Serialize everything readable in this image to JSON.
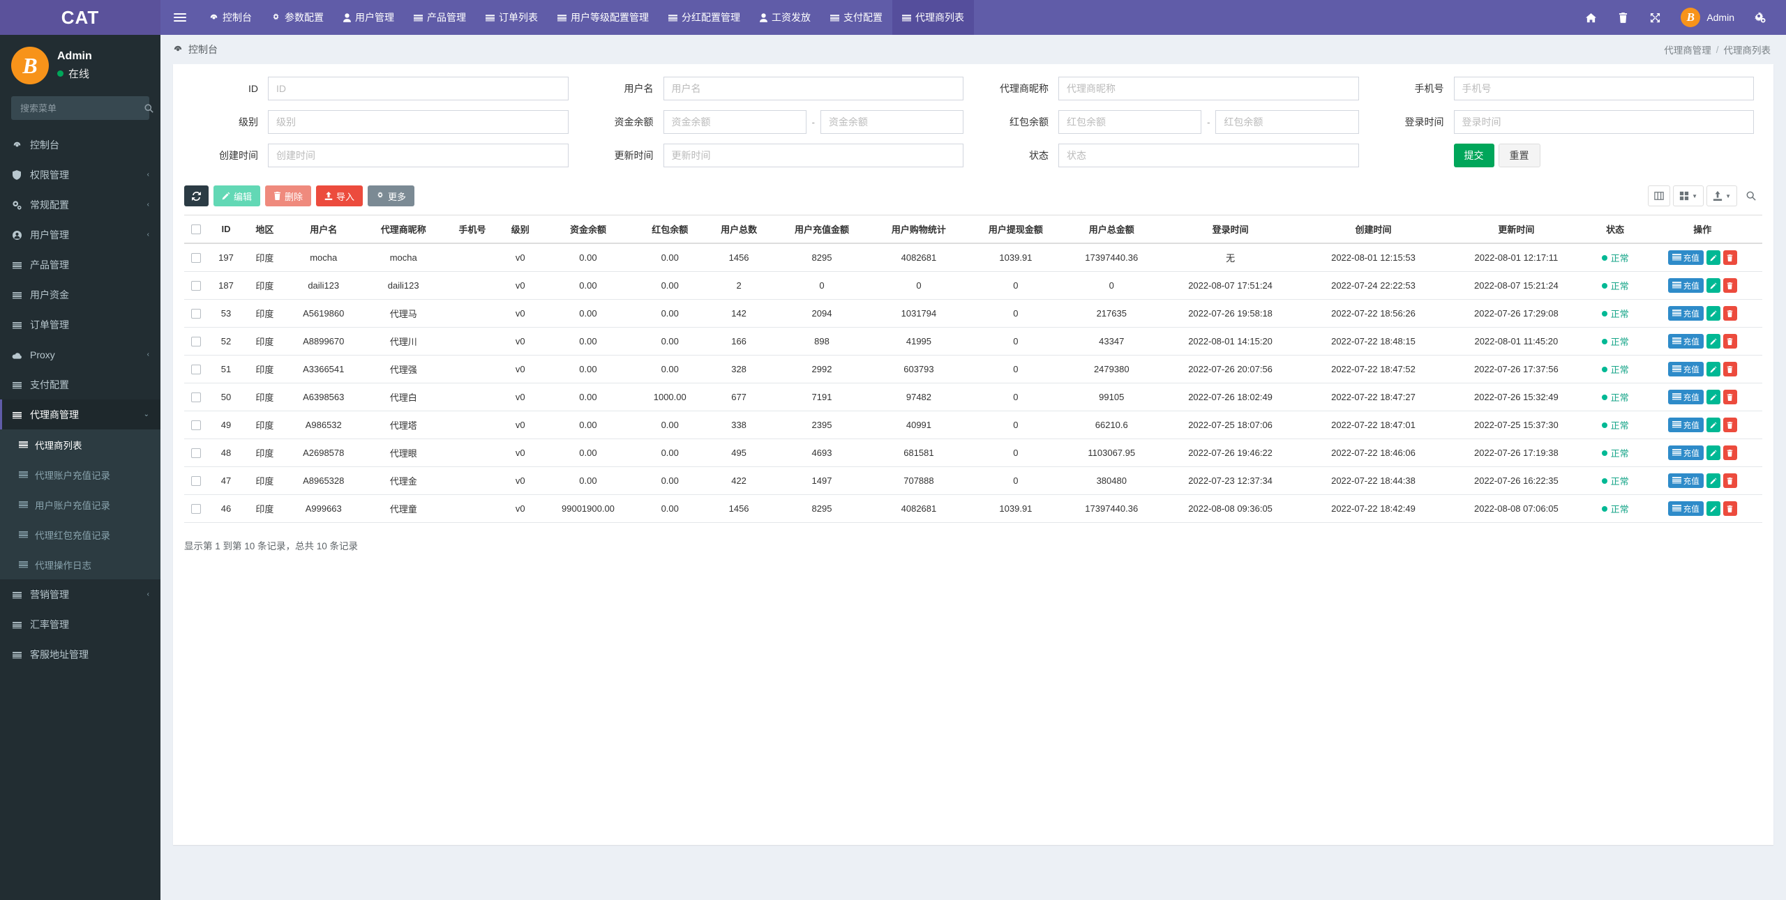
{
  "brand": {
    "title": "CAT"
  },
  "topnav": {
    "toggle_icon": "hamburger-icon",
    "items": [
      {
        "label": "控制台",
        "icon": "dashboard-icon",
        "active": false
      },
      {
        "label": "参数配置",
        "icon": "gear-icon",
        "active": false
      },
      {
        "label": "用户管理",
        "icon": "user-icon",
        "active": false
      },
      {
        "label": "产品管理",
        "icon": "list-icon",
        "active": false
      },
      {
        "label": "订单列表",
        "icon": "list-icon",
        "active": false
      },
      {
        "label": "用户等级配置管理",
        "icon": "list-icon",
        "active": false
      },
      {
        "label": "分红配置管理",
        "icon": "list-icon",
        "active": false
      },
      {
        "label": "工资发放",
        "icon": "user-icon",
        "active": false
      },
      {
        "label": "支付配置",
        "icon": "list-icon",
        "active": false
      },
      {
        "label": "代理商列表",
        "icon": "list-icon",
        "active": true
      }
    ],
    "right_icons": [
      {
        "name": "home-icon",
        "glyph": "⌂"
      },
      {
        "name": "trash-icon",
        "glyph": "Ὕ1"
      },
      {
        "name": "fullscreen-icon",
        "glyph": "⤢"
      }
    ],
    "user": {
      "name": "Admin",
      "avatar": "bitcoin-icon",
      "avatar_letter": "B"
    },
    "settings_icon": "gears-icon"
  },
  "sidebar": {
    "user": {
      "name": "Admin",
      "status": "在线",
      "avatar_letter": "B"
    },
    "search": {
      "placeholder": "搜索菜单",
      "value": "",
      "icon": "search-icon"
    },
    "menu": [
      {
        "label": "控制台",
        "icon": "dashboard-icon",
        "caret": false
      },
      {
        "label": "权限管理",
        "icon": "shield-icon",
        "caret": true
      },
      {
        "label": "常规配置",
        "icon": "gears-icon",
        "caret": true
      },
      {
        "label": "用户管理",
        "icon": "user-circle-icon",
        "caret": true
      },
      {
        "label": "产品管理",
        "icon": "list-icon",
        "caret": false
      },
      {
        "label": "用户资金",
        "icon": "list-icon",
        "caret": false
      },
      {
        "label": "订单管理",
        "icon": "list-icon",
        "caret": false
      },
      {
        "label": "Proxy",
        "icon": "cloud-icon",
        "caret": true
      },
      {
        "label": "支付配置",
        "icon": "list-icon",
        "caret": false
      },
      {
        "label": "代理商管理",
        "icon": "list-icon",
        "caret": true,
        "open": true,
        "children": [
          {
            "label": "代理商列表",
            "icon": "list-icon",
            "active": true
          },
          {
            "label": "代理账户充值记录",
            "icon": "list-icon",
            "active": false
          },
          {
            "label": "用户账户充值记录",
            "icon": "list-icon",
            "active": false
          },
          {
            "label": "代理红包充值记录",
            "icon": "list-icon",
            "active": false
          },
          {
            "label": "代理操作日志",
            "icon": "list-icon",
            "active": false
          }
        ]
      },
      {
        "label": "营销管理",
        "icon": "list-icon",
        "caret": true
      },
      {
        "label": "汇率管理",
        "icon": "list-icon",
        "caret": false
      },
      {
        "label": "客服地址管理",
        "icon": "list-icon",
        "caret": false
      }
    ]
  },
  "content_header": {
    "title": "控制台",
    "title_icon": "dashboard-icon",
    "breadcrumb": [
      "代理商管理",
      "代理商列表"
    ],
    "breadcrumb_sep": "/"
  },
  "search_form": {
    "fields": [
      {
        "label": "ID",
        "placeholder": "ID",
        "value": "",
        "type": "text"
      },
      {
        "label": "用户名",
        "placeholder": "用户名",
        "value": "",
        "type": "text"
      },
      {
        "label": "代理商昵称",
        "placeholder": "代理商昵称",
        "value": "",
        "type": "text"
      },
      {
        "label": "手机号",
        "placeholder": "手机号",
        "value": "",
        "type": "text"
      },
      {
        "label": "级别",
        "placeholder": "级别",
        "value": "",
        "type": "text"
      },
      {
        "label": "资金余额",
        "placeholder": "资金余额",
        "placeholder2": "资金余额",
        "value": "",
        "value2": "",
        "type": "range"
      },
      {
        "label": "红包余额",
        "placeholder": "红包余额",
        "placeholder2": "红包余额",
        "value": "",
        "value2": "",
        "type": "range"
      },
      {
        "label": "登录时间",
        "placeholder": "登录时间",
        "value": "",
        "type": "text"
      },
      {
        "label": "创建时间",
        "placeholder": "创建时间",
        "value": "",
        "type": "text"
      },
      {
        "label": "更新时间",
        "placeholder": "更新时间",
        "value": "",
        "type": "text"
      },
      {
        "label": "状态",
        "placeholder": "状态",
        "value": "",
        "type": "text"
      }
    ],
    "submit_label": "提交",
    "reset_label": "重置"
  },
  "toolbar": {
    "refresh_icon": "refresh-icon",
    "buttons": [
      {
        "label": "编辑",
        "icon": "pencil-icon",
        "style": "teal"
      },
      {
        "label": "删除",
        "icon": "trash-icon",
        "style": "salmon"
      },
      {
        "label": "导入",
        "icon": "upload-icon",
        "style": "red"
      },
      {
        "label": "更多",
        "icon": "gear-icon",
        "style": "gray"
      }
    ],
    "right_tools": [
      {
        "name": "columns-icon"
      },
      {
        "name": "grid-icon"
      },
      {
        "name": "export-icon"
      },
      {
        "name": "search-icon"
      }
    ]
  },
  "table": {
    "columns": [
      "ID",
      "地区",
      "用户名",
      "代理商昵称",
      "手机号",
      "级别",
      "资金余额",
      "红包余额",
      "用户总数",
      "用户充值金额",
      "用户购物统计",
      "用户提现金额",
      "用户总金额",
      "登录时间",
      "创建时间",
      "更新时间",
      "状态",
      "操作"
    ],
    "rows": [
      {
        "id": "197",
        "region": "印度",
        "username": "mocha",
        "nickname": "mocha",
        "phone": "",
        "level": "v0",
        "balance": "0.00",
        "redpacket": "0.00",
        "user_total": "1456",
        "user_recharge": "8295",
        "user_shopping": "4082681",
        "user_withdraw": "1039.91",
        "user_amount": "17397440.36",
        "login_time": "无",
        "create_time": "2022-08-01 12:15:53",
        "update_time": "2022-08-01 12:17:11",
        "status": "正常"
      },
      {
        "id": "187",
        "region": "印度",
        "username": "daili123",
        "nickname": "daili123",
        "phone": "",
        "level": "v0",
        "balance": "0.00",
        "redpacket": "0.00",
        "user_total": "2",
        "user_recharge": "0",
        "user_shopping": "0",
        "user_withdraw": "0",
        "user_amount": "0",
        "login_time": "2022-08-07 17:51:24",
        "create_time": "2022-07-24 22:22:53",
        "update_time": "2022-08-07 15:21:24",
        "status": "正常"
      },
      {
        "id": "53",
        "region": "印度",
        "username": "A5619860",
        "nickname": "代理马",
        "phone": "",
        "level": "v0",
        "balance": "0.00",
        "redpacket": "0.00",
        "user_total": "142",
        "user_recharge": "2094",
        "user_shopping": "1031794",
        "user_withdraw": "0",
        "user_amount": "217635",
        "login_time": "2022-07-26 19:58:18",
        "create_time": "2022-07-22 18:56:26",
        "update_time": "2022-07-26 17:29:08",
        "status": "正常"
      },
      {
        "id": "52",
        "region": "印度",
        "username": "A8899670",
        "nickname": "代理川",
        "phone": "",
        "level": "v0",
        "balance": "0.00",
        "redpacket": "0.00",
        "user_total": "166",
        "user_recharge": "898",
        "user_shopping": "41995",
        "user_withdraw": "0",
        "user_amount": "43347",
        "login_time": "2022-08-01 14:15:20",
        "create_time": "2022-07-22 18:48:15",
        "update_time": "2022-08-01 11:45:20",
        "status": "正常"
      },
      {
        "id": "51",
        "region": "印度",
        "username": "A3366541",
        "nickname": "代理强",
        "phone": "",
        "level": "v0",
        "balance": "0.00",
        "redpacket": "0.00",
        "user_total": "328",
        "user_recharge": "2992",
        "user_shopping": "603793",
        "user_withdraw": "0",
        "user_amount": "2479380",
        "login_time": "2022-07-26 20:07:56",
        "create_time": "2022-07-22 18:47:52",
        "update_time": "2022-07-26 17:37:56",
        "status": "正常"
      },
      {
        "id": "50",
        "region": "印度",
        "username": "A6398563",
        "nickname": "代理白",
        "phone": "",
        "level": "v0",
        "balance": "0.00",
        "redpacket": "1000.00",
        "user_total": "677",
        "user_recharge": "7191",
        "user_shopping": "97482",
        "user_withdraw": "0",
        "user_amount": "99105",
        "login_time": "2022-07-26 18:02:49",
        "create_time": "2022-07-22 18:47:27",
        "update_time": "2022-07-26 15:32:49",
        "status": "正常"
      },
      {
        "id": "49",
        "region": "印度",
        "username": "A986532",
        "nickname": "代理塔",
        "phone": "",
        "level": "v0",
        "balance": "0.00",
        "redpacket": "0.00",
        "user_total": "338",
        "user_recharge": "2395",
        "user_shopping": "40991",
        "user_withdraw": "0",
        "user_amount": "66210.6",
        "login_time": "2022-07-25 18:07:06",
        "create_time": "2022-07-22 18:47:01",
        "update_time": "2022-07-25 15:37:30",
        "status": "正常"
      },
      {
        "id": "48",
        "region": "印度",
        "username": "A2698578",
        "nickname": "代理眼",
        "phone": "",
        "level": "v0",
        "balance": "0.00",
        "redpacket": "0.00",
        "user_total": "495",
        "user_recharge": "4693",
        "user_shopping": "681581",
        "user_withdraw": "0",
        "user_amount": "1103067.95",
        "login_time": "2022-07-26 19:46:22",
        "create_time": "2022-07-22 18:46:06",
        "update_time": "2022-07-26 17:19:38",
        "status": "正常"
      },
      {
        "id": "47",
        "region": "印度",
        "username": "A8965328",
        "nickname": "代理金",
        "phone": "",
        "level": "v0",
        "balance": "0.00",
        "redpacket": "0.00",
        "user_total": "422",
        "user_recharge": "1497",
        "user_shopping": "707888",
        "user_withdraw": "0",
        "user_amount": "380480",
        "login_time": "2022-07-23 12:37:34",
        "create_time": "2022-07-22 18:44:38",
        "update_time": "2022-07-26 16:22:35",
        "status": "正常"
      },
      {
        "id": "46",
        "region": "印度",
        "username": "A999663",
        "nickname": "代理童",
        "phone": "",
        "level": "v0",
        "balance": "99001900.00",
        "redpacket": "0.00",
        "user_total": "1456",
        "user_recharge": "8295",
        "user_shopping": "4082681",
        "user_withdraw": "1039.91",
        "user_amount": "17397440.36",
        "login_time": "2022-08-08 09:36:05",
        "create_time": "2022-07-22 18:42:49",
        "update_time": "2022-08-08 07:06:05",
        "status": "正常"
      }
    ],
    "row_ops": {
      "recharge_label": "充值",
      "edit_icon": "pencil-icon",
      "delete_icon": "trash-icon",
      "recharge_icon": "list-icon"
    },
    "footer_text": "显示第 1 到第 10 条记录，总共 10 条记录"
  },
  "colors": {
    "brand_purple": "#5b529b",
    "topbar_purple": "#605ca8",
    "sidebar_dark": "#222d32",
    "submenu_dark": "#2c3b41",
    "accent_green": "#00a65a",
    "bitcoin_orange": "#f7931a",
    "status_green": "#00b894",
    "danger_red": "#ec4b3d"
  }
}
